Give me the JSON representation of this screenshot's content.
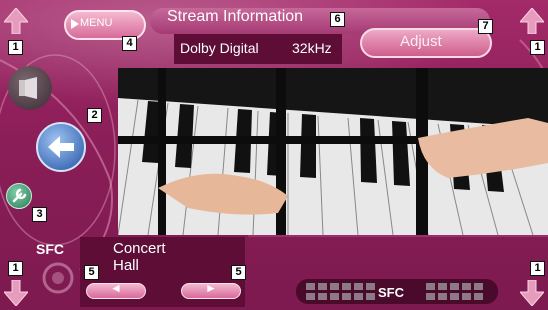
{
  "header": {
    "title": "Stream Information",
    "menu_label": "MENU",
    "adjust_label": "Adjust"
  },
  "stream_info": {
    "format": "Dolby Digital",
    "sample_rate": "32kHz"
  },
  "sfc_panel": {
    "heading": "SFC",
    "mode_line1": "Concert",
    "mode_line2": "Hall"
  },
  "sfc_meter": {
    "label": "SFC"
  },
  "callouts": {
    "n1": "1",
    "n2": "2",
    "n3": "3",
    "n4": "4",
    "n5": "5",
    "n6": "6",
    "n7": "7"
  },
  "icons": [
    "menu-play-icon",
    "hide-icon",
    "return-icon",
    "wrench-icon",
    "scroll-up-icon",
    "scroll-down-icon",
    "left-arrow-icon",
    "right-arrow-icon"
  ],
  "colors": {
    "background": "#8b1e58",
    "panel": "#5d0d36",
    "button": "#e08aae"
  }
}
